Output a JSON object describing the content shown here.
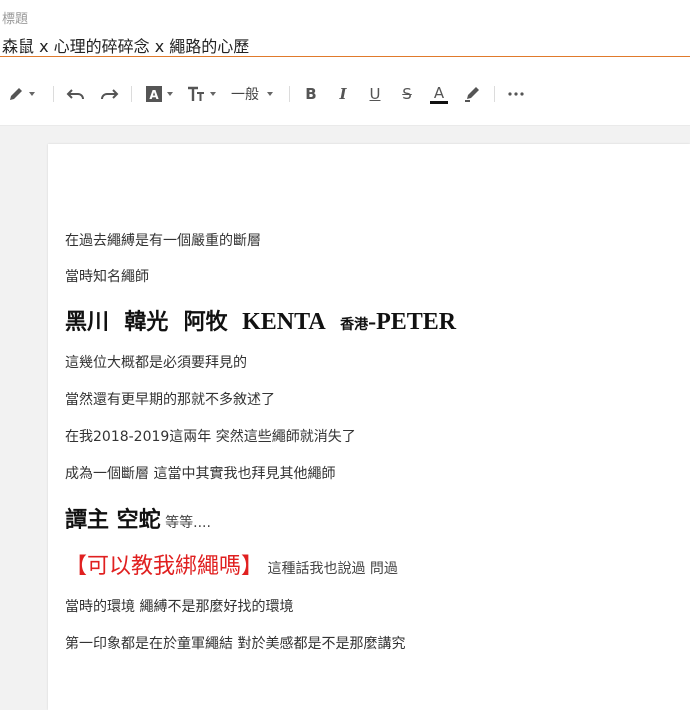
{
  "title": {
    "label": "標題",
    "value": "森鼠 x 心理的碎碎念 x 繩路的心歷"
  },
  "toolbar": {
    "paragraph_style": "一般",
    "icons": [
      "pen-icon",
      "undo-icon",
      "redo-icon",
      "font-color-box-icon",
      "text-size-icon",
      "bold-icon",
      "italic-icon",
      "underline-icon",
      "strikethrough-icon",
      "font-color-icon",
      "highlight-icon",
      "more-icon"
    ],
    "bold": "B",
    "italic": "I",
    "underline": "U",
    "strike": "S",
    "fontcolor": "A",
    "font_color_accent": "#111111"
  },
  "content": {
    "p1": "在過去繩縛是有一個嚴重的斷層",
    "p2": "當時知名繩師",
    "p3_names": "黑川  韓光  阿牧",
    "p3_kenta": "KENTA",
    "p3_hk": "香港",
    "p3_peter": "-PETER",
    "p4": "這幾位大概都是必須要拜見的",
    "p5": "當然還有更早期的那就不多敘述了",
    "p6": "在我2018-2019這兩年 突然這些繩師就消失了",
    "p7": "成為一個斷層 這當中其實我也拜見其他繩師",
    "p8_names": "譚主 空蛇",
    "p8_etc": "等等....",
    "p9_red": "【可以教我綁繩嗎】",
    "p9_rest": "這種話我也說過 問過",
    "p10": "當時的環境 繩縛不是那麼好找的環境",
    "p11": "第一印象都是在於童軍繩結 對於美感都是不是那麼講究",
    "red_color": "#e02020"
  }
}
